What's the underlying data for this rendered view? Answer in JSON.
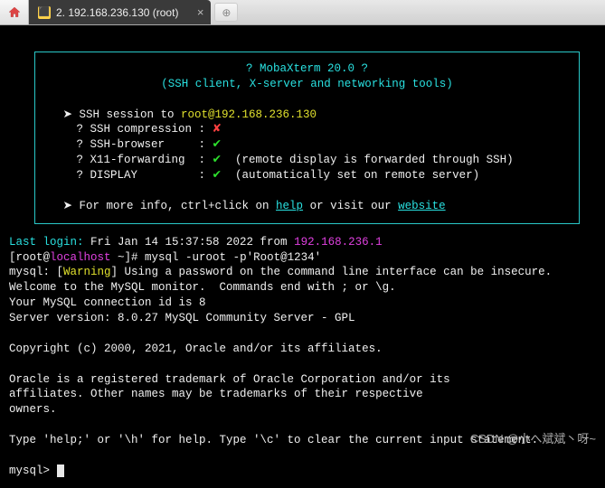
{
  "tab": {
    "title": "2. 192.168.236.130 (root)"
  },
  "banner": {
    "title": "? MobaXterm 20.0 ?",
    "subtitle": "(SSH client, X-server and networking tools)",
    "session_prefix": "SSH session to ",
    "session_user": "root@192.168.236.130",
    "lines": {
      "compression": "? SSH compression : ",
      "browser": "? SSH-browser     : ",
      "x11": "? X11-forwarding  : ",
      "display": "? DISPLAY         : "
    },
    "marks": {
      "fail": "✘",
      "ok": "✔"
    },
    "x11_note": "  (remote display is forwarded through SSH)",
    "display_note": "  (automatically set on remote server)",
    "footer_pre": "For more ",
    "footer_info": "info",
    "footer_mid": ", ctrl+click on ",
    "footer_help": "help",
    "footer_mid2": " or visit our ",
    "footer_site": "website"
  },
  "body": {
    "last_login_label": "Last login:",
    "last_login_time": " Fri Jan 14 15:37:58 2022 from ",
    "last_login_ip": "192.168.236.1",
    "prompt_open": "[root@",
    "prompt_host": "localhost",
    "prompt_rest": " ~]# ",
    "command": "mysql -uroot -p'Root@1234'",
    "warn_prefix": "mysql: [",
    "warn_word": "Warning",
    "warn_rest": "] Using a password on the command line interface can be insecure.",
    "welcome": "Welcome to the MySQL monitor.  Commands end with ; or \\g.",
    "conn_id": "Your MySQL connection id is 8",
    "server_ver": "Server version: 8.0.27 MySQL Community Server - GPL",
    "copyright": "Copyright (c) 2000, 2021, Oracle and/or its affiliates.",
    "trademark1": "Oracle is a registered trademark of Oracle Corporation and/or its",
    "trademark2": "affiliates. Other names may be trademarks of their respective",
    "trademark3": "owners.",
    "help": "Type 'help;' or '\\h' for help. Type '\\c' to clear the current input statement.",
    "mysql_prompt": "mysql> "
  },
  "watermark": "CSDN @小へ斌斌丶呀~"
}
